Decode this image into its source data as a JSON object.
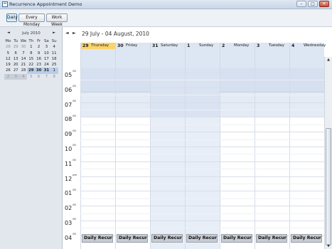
{
  "window": {
    "title": "Recurrence Appointment Demo",
    "minimize": "–",
    "maximize": "□",
    "close": "✕"
  },
  "toolbar": {
    "daily": "Daily",
    "every_monday": "Every Monday",
    "work_week": "Work Week"
  },
  "mini_calendar": {
    "title": "July 2010",
    "prev": "◄",
    "next": "►",
    "weekdays": [
      "Mo",
      "Tu",
      "We",
      "Th",
      "Fr",
      "Sa",
      "Su"
    ],
    "weeks": [
      [
        "28",
        "29",
        "30",
        "1",
        "2",
        "3",
        "4"
      ],
      [
        "5",
        "6",
        "7",
        "8",
        "9",
        "10",
        "11"
      ],
      [
        "12",
        "13",
        "14",
        "15",
        "16",
        "17",
        "18"
      ],
      [
        "19",
        "20",
        "21",
        "22",
        "23",
        "24",
        "25"
      ],
      [
        "26",
        "27",
        "28",
        "29",
        "30",
        "31",
        "1"
      ],
      [
        "2",
        "3",
        "4",
        "5",
        "6",
        "7",
        "8"
      ]
    ]
  },
  "scheduler": {
    "prev": "◄",
    "next": "►",
    "date_range": "29 July - 04 August, 2010",
    "days": [
      {
        "num": "29",
        "name": "Thursday",
        "today": true
      },
      {
        "num": "30",
        "name": "Friday"
      },
      {
        "num": "31",
        "name": "Saturday",
        "weekend": true
      },
      {
        "num": "1",
        "name": "Sunday",
        "weekend": true
      },
      {
        "num": "2",
        "name": "Monday"
      },
      {
        "num": "3",
        "name": "Tuesday"
      },
      {
        "num": "4",
        "name": "Wednesday"
      }
    ],
    "hours": [
      {
        "h": "05",
        "m": "00"
      },
      {
        "h": "06",
        "m": "00"
      },
      {
        "h": "07",
        "m": "00"
      },
      {
        "h": "08",
        "m": "00"
      },
      {
        "h": "09",
        "m": "00"
      },
      {
        "h": "10",
        "m": "00"
      },
      {
        "h": "11",
        "m": "00"
      },
      {
        "h": "12",
        "m": "pm"
      },
      {
        "h": "01",
        "m": "00"
      },
      {
        "h": "02",
        "m": "00"
      },
      {
        "h": "03",
        "m": "00"
      },
      {
        "h": "04",
        "m": "00"
      }
    ],
    "appointment_label": "Daily Recur"
  },
  "scroll": {
    "up": "▲",
    "down": "▼"
  }
}
